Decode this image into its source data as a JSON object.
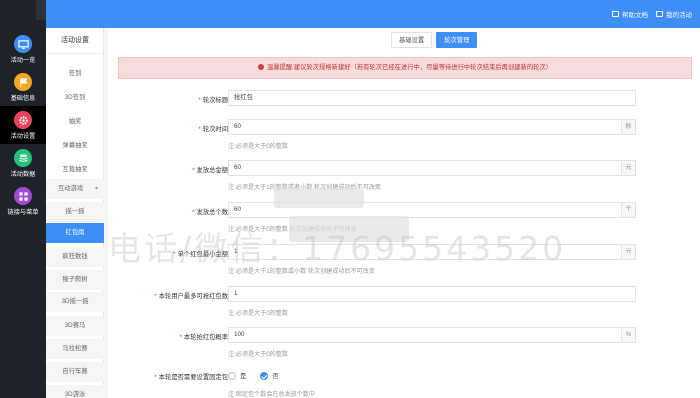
{
  "header": {
    "links": [
      {
        "label": "帮助文档",
        "icon": "book-icon"
      },
      {
        "label": "我的活动",
        "icon": "list-icon"
      }
    ]
  },
  "leftnav": {
    "items": [
      {
        "label": "活动一览",
        "icon": "monitor-icon",
        "color": "#3e8ef7"
      },
      {
        "label": "基础信息",
        "icon": "flag-icon",
        "color": "#f5a623"
      },
      {
        "label": "活动设置",
        "icon": "gear-icon",
        "color": "#e8435a"
      },
      {
        "label": "活动数据",
        "icon": "database-icon",
        "color": "#23c277"
      },
      {
        "label": "链接与菜单",
        "icon": "grid-icon",
        "color": "#a24ad6"
      }
    ]
  },
  "subnav": {
    "title": "活动设置",
    "items": [
      "签到",
      "3D签到",
      "抽奖",
      "弹幕抽奖",
      "互裁抽奖"
    ],
    "group": "互动游戏",
    "children": [
      "摇一摇",
      "红包雨",
      "疯狂数钱",
      "猴子爬树",
      "3D摇一摇",
      "3D赛马",
      "马拉松赛",
      "自行车赛",
      "3D游泳"
    ]
  },
  "tabs": [
    "基础设置",
    "轮次管理"
  ],
  "alert": "温馨提醒:建议轮次规格新建好（若有轮次已经在进行中，尽量等待进行中轮次结束后再创建新的轮次）",
  "form": {
    "round_title": {
      "label": "轮次标题",
      "value": "抢红包"
    },
    "round_time": {
      "label": "轮次时间",
      "value": "60",
      "unit": "秒",
      "help": "注:必须是大于0的整数"
    },
    "total_amount": {
      "label": "发放总金额",
      "value": "60",
      "unit": "元",
      "help": "注:必须是大于1的整数或者小数 轮次创建成功后不可改变"
    },
    "total_count": {
      "label": "发放总个数",
      "value": "60",
      "unit": "个",
      "help": "注:必须是大于0的整数 轮次创建成功后不可改变"
    },
    "min_amount": {
      "label": "单个红包最小金额",
      "value": "1",
      "unit": "元",
      "help": "注:必须是大于1的整数或小数 轮次创建成功后不可改变"
    },
    "max_grab": {
      "label": "本轮用户最多可抢红包数",
      "value": "1",
      "help": "注:必须是大于0的整数"
    },
    "probability": {
      "label": "本轮抢红包概率",
      "value": "100",
      "unit": "%",
      "help": "注:必须是大于0的整数"
    },
    "fixed_flag": {
      "label": "本轮是否需要设置固定包",
      "yes": "是",
      "no": "否",
      "selected": "否",
      "help": "注:固定包个数会在总发放个数中"
    }
  },
  "watermark": "电话/微信：17695543520"
}
